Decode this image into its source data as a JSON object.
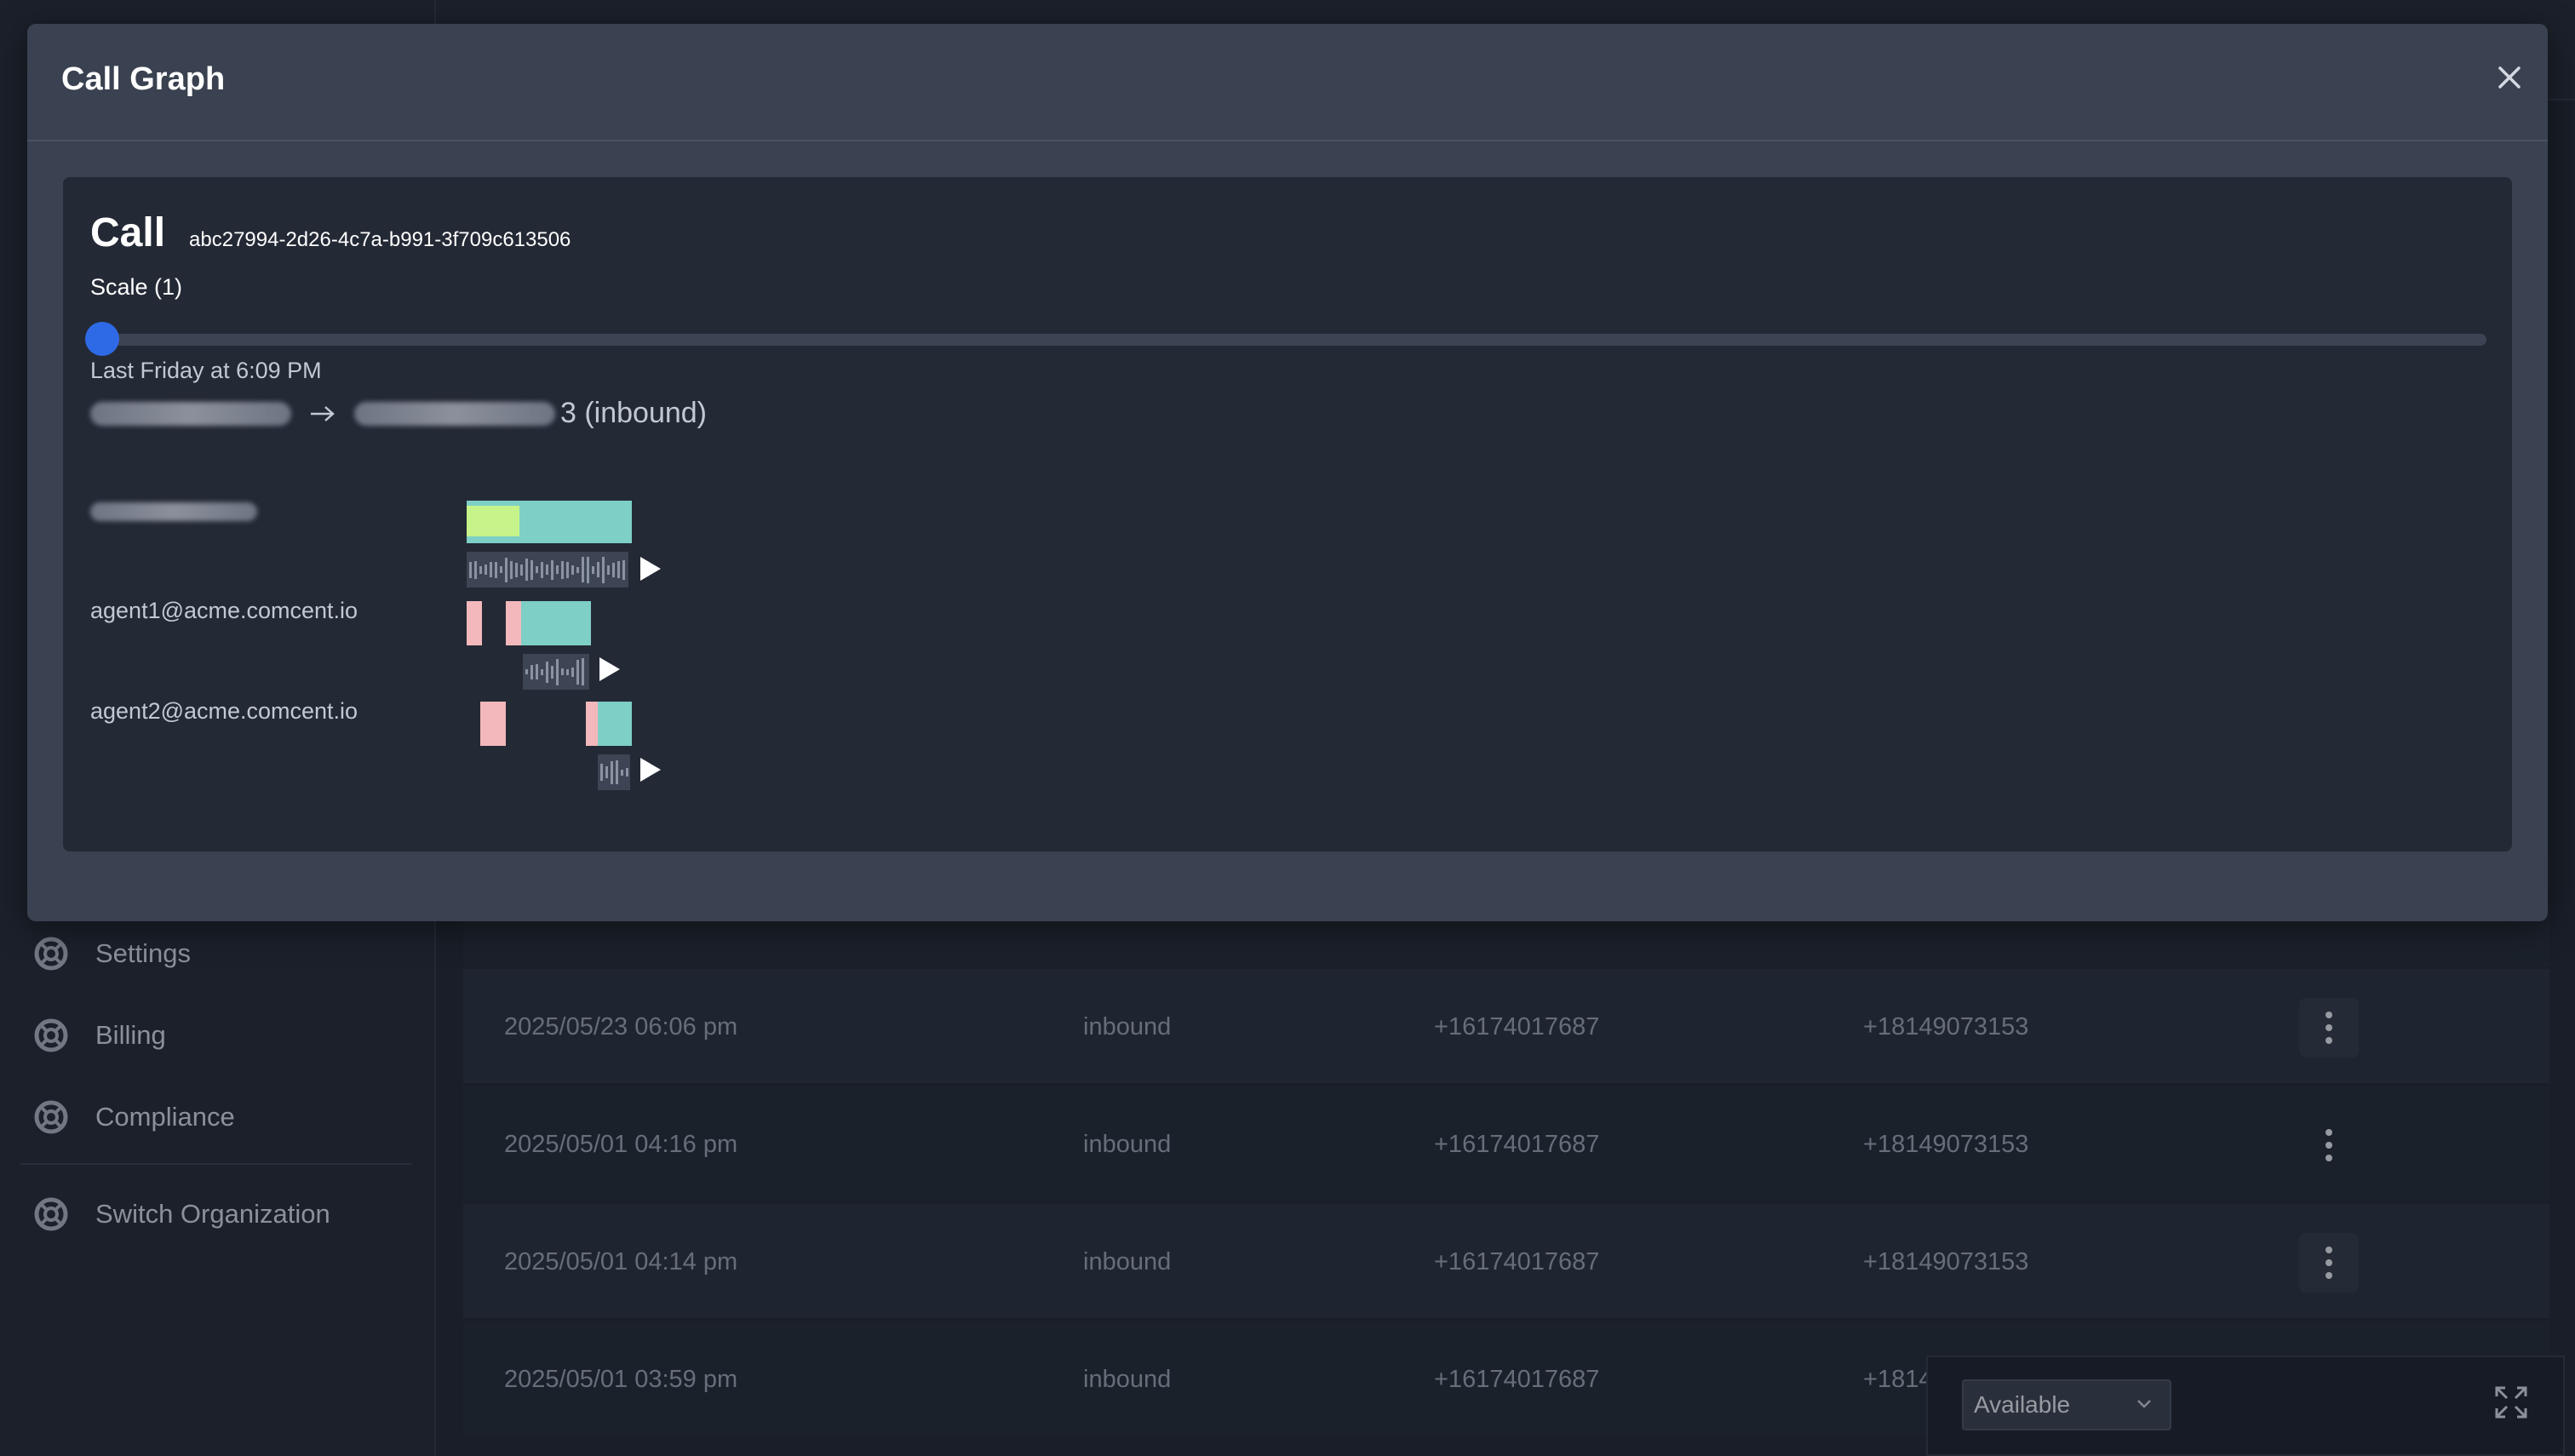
{
  "sidebar": {
    "items": [
      {
        "label": "Settings",
        "icon": "lifebuoy-icon"
      },
      {
        "label": "Billing",
        "icon": "lifebuoy-icon"
      },
      {
        "label": "Compliance",
        "icon": "lifebuoy-icon"
      },
      {
        "label": "Switch Organization",
        "icon": "lifebuoy-icon"
      }
    ]
  },
  "calls_table": {
    "rows": [
      {
        "date": "2025/05/23 06:06 pm",
        "direction": "inbound",
        "from": "+16174017687",
        "to": "+18149073153"
      },
      {
        "date": "2025/05/01 04:16 pm",
        "direction": "inbound",
        "from": "+16174017687",
        "to": "+18149073153"
      },
      {
        "date": "2025/05/01 04:14 pm",
        "direction": "inbound",
        "from": "+16174017687",
        "to": "+18149073153"
      },
      {
        "date": "2025/05/01 03:59 pm",
        "direction": "inbound",
        "from": "+16174017687",
        "to": "+1814"
      }
    ]
  },
  "status_widget": {
    "selected": "Available"
  },
  "modal": {
    "title": "Call Graph",
    "call_label": "Call",
    "call_id": "abc27994-2d26-4c7a-b991-3f709c613506",
    "scale_label": "Scale (1)",
    "scale_value": 1,
    "timestamp": "Last Friday at 6:09 PM",
    "route_suffix": "3 (inbound)",
    "lanes": [
      {
        "label": ""
      },
      {
        "label": "agent1@acme.comcent.io"
      },
      {
        "label": "agent2@acme.comcent.io"
      }
    ]
  },
  "colors": {
    "accent": "#2f6ae6",
    "talk": "#7ecfc6",
    "ring": "#f2b8bb",
    "ivr": "#c6f48a"
  }
}
